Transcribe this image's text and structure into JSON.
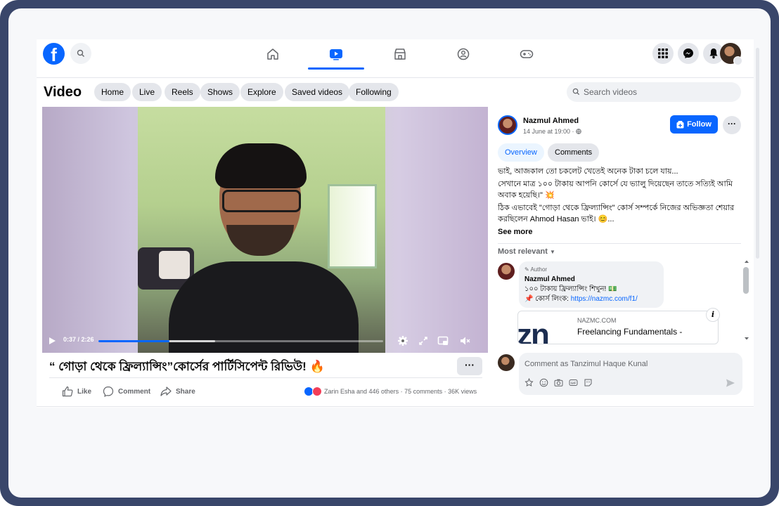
{
  "topnav": {
    "logo_letter": "f",
    "nav_items": [
      {
        "name": "home-icon"
      },
      {
        "name": "video-icon",
        "active": true
      },
      {
        "name": "marketplace-icon"
      },
      {
        "name": "groups-icon"
      },
      {
        "name": "gaming-icon"
      }
    ],
    "right_buttons": [
      "menu-icon",
      "messenger-icon",
      "notifications-icon",
      "profile-avatar"
    ]
  },
  "subnav": {
    "title": "Video",
    "chips": [
      "Home",
      "Live",
      "Reels",
      "Shows",
      "Explore",
      "Saved videos",
      "Following"
    ],
    "search_placeholder": "Search videos"
  },
  "video": {
    "time": "0:37 / 2:26",
    "progress_fraction": 0.25,
    "buffer_fraction": 0.41,
    "title": "“ গোড়া থেকে ফ্রিল্যান্সিং”কোর্সের পার্টিসিপেন্ট রিভিউ! 🔥",
    "more_label": "···"
  },
  "actions": {
    "like": "Like",
    "comment": "Comment",
    "share": "Share",
    "stats": "Zarin Esha and 446 others · 75 comments · 36K views"
  },
  "post": {
    "author": "Nazmul Ahmed",
    "time": "14 June at 19:00 ·",
    "follow_label": "Follow",
    "dots": "···",
    "tabs": {
      "overview": "Overview",
      "comments": "Comments"
    },
    "description": [
      "ভাই, আজকাল তো চকলেট খেতেই অনেক টাকা চলে যায়...",
      "সেখানে মাত্র ১০০ টাকায় আপনি কোর্সে যে ভ্যালু দিয়েছেন তাতে সত্যিই আমি অবাক হয়েছি।\" 💥",
      "ঠিক এভাবেই \"গোড়া থেকে ফ্রিল্যান্সিং\" কোর্স সম্পর্কে নিজের অভিজ্ঞতা শেয়ার করছিলেন Ahmod Hasan ভাই। 😊..."
    ],
    "see_more": "See more"
  },
  "comments": {
    "filter": "Most relevant",
    "first": {
      "author_tag": "Author",
      "name": "Nazmul Ahmed",
      "line1": "১০০ টাকায় ফ্রিল্যান্সিং শিখুন! 💵",
      "line2_prefix": "📌 কোর্স লিংক: ",
      "link": "https://nazmc.com/f1/"
    },
    "link_card": {
      "logo_text": "zn",
      "domain": "NAZMC.COM",
      "title": "Freelancing Fundamentals -"
    },
    "composer_placeholder": "Comment as Tanzimul Haque Kunal"
  },
  "colors": {
    "accent": "#0866ff",
    "frame": "#39466a",
    "chip_bg": "#e4e6eb"
  }
}
